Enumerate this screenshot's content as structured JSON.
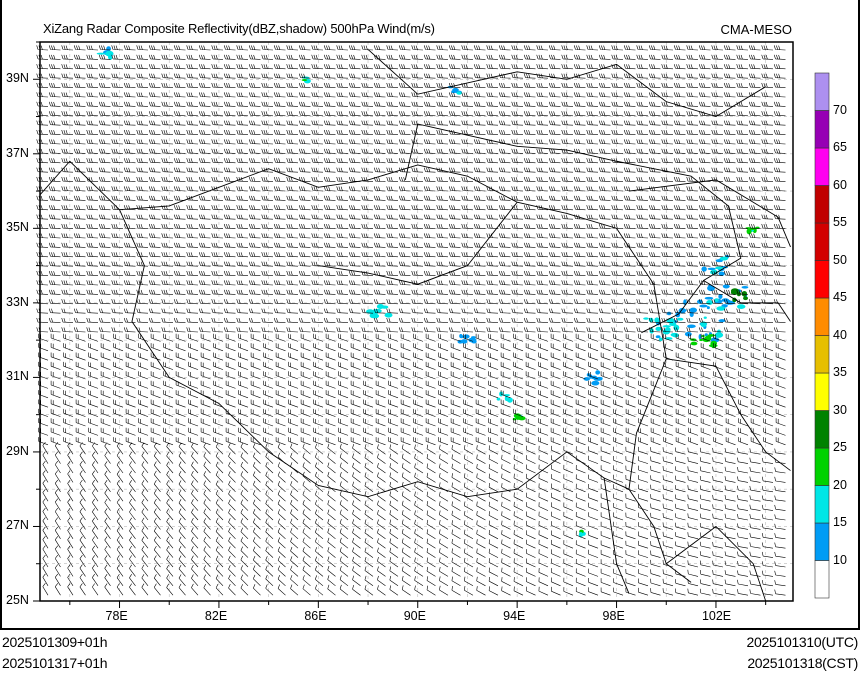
{
  "title": "XiZang Radar Composite Reflectivity(dBZ,shadow) 500hPa Wind(m/s)",
  "model": "CMA-MESO",
  "map": {
    "lon_range": [
      74.8,
      105.1
    ],
    "lat_range": [
      25,
      40
    ],
    "lon_ticks": [
      "78E",
      "82E",
      "86E",
      "90E",
      "94E",
      "98E",
      "102E"
    ],
    "lon_tick_values": [
      78,
      82,
      86,
      90,
      94,
      98,
      102
    ],
    "lat_ticks": [
      "39N",
      "37N",
      "35N",
      "33N",
      "31N",
      "29N",
      "27N",
      "25N"
    ],
    "lat_tick_values": [
      39,
      37,
      35,
      33,
      31,
      29,
      27,
      25
    ]
  },
  "colorbar": {
    "labels": [
      "10",
      "15",
      "20",
      "25",
      "30",
      "35",
      "40",
      "45",
      "50",
      "55",
      "60",
      "65",
      "70"
    ],
    "colors": [
      "#ffffff",
      "#009cf5",
      "#00e6e6",
      "#00d200",
      "#008200",
      "#ffff00",
      "#e6bf00",
      "#ff8c00",
      "#ff0000",
      "#d20000",
      "#c00000",
      "#ff00f0",
      "#9600b4",
      "#ad90f0"
    ]
  },
  "footer": {
    "init_utc": "2025101309+01h",
    "init_cst": "2025101317+01h",
    "valid_utc": "2025101310(UTC)",
    "valid_cst": "2025101318(CST)"
  }
}
